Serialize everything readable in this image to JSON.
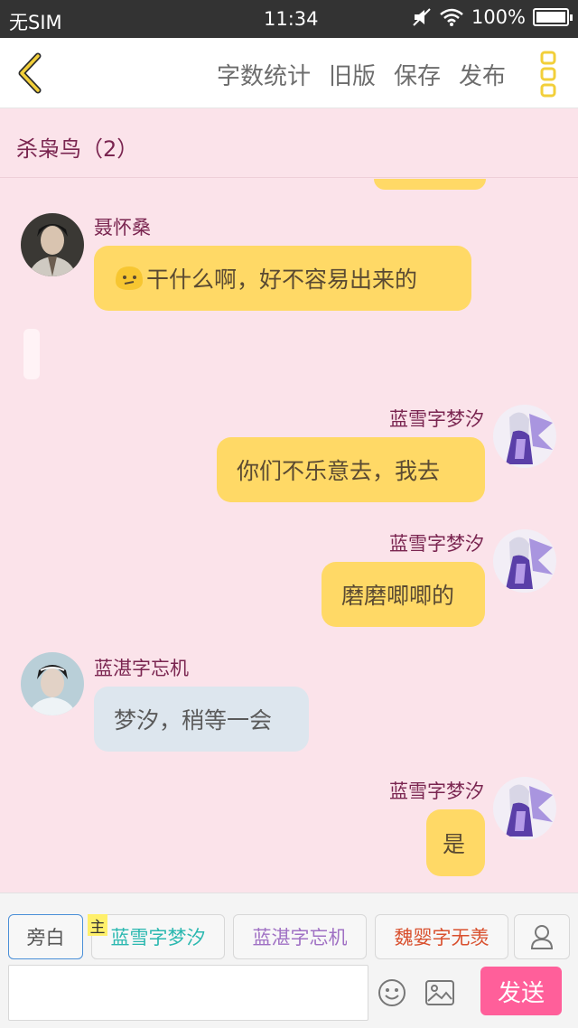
{
  "status_bar": {
    "carrier": "无SIM",
    "time": "11:34",
    "battery": "100%"
  },
  "header": {
    "menu": [
      "字数统计",
      "旧版",
      "保存",
      "发布"
    ]
  },
  "chat": {
    "title": "杀枭鸟（2）"
  },
  "messages": [
    {
      "side": "left",
      "name": "聂怀桑",
      "text": "干什么啊，好不容易出来的",
      "emoji": "confused-face"
    },
    {
      "side": "right",
      "name": "蓝雪字梦汐",
      "text": "你们不乐意去，我去"
    },
    {
      "side": "right",
      "name": "蓝雪字梦汐",
      "text": "磨磨唧唧的"
    },
    {
      "side": "left",
      "name": "蓝湛字忘机",
      "text": "梦汐，稍等一会"
    },
    {
      "side": "right",
      "name": "蓝雪字梦汐",
      "text": "是"
    }
  ],
  "bottom": {
    "roles": [
      {
        "label": "旁白",
        "color": "#666666"
      },
      {
        "label": "蓝雪字梦汐",
        "color": "#2bb8b0",
        "badge": "主"
      },
      {
        "label": "蓝湛字忘机",
        "color": "#a071c4"
      },
      {
        "label": "魏婴字无羡",
        "color": "#d9502e"
      }
    ],
    "input_placeholder": "",
    "send_label": "发送"
  }
}
